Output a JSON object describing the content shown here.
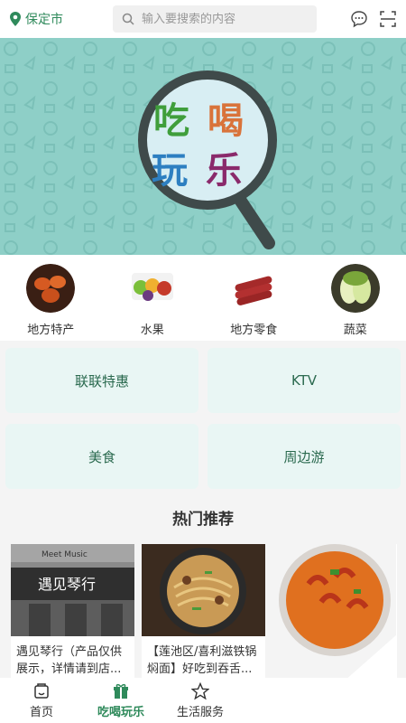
{
  "topbar": {
    "location": "保定市",
    "search_placeholder": "输入要搜索的内容"
  },
  "banner": {
    "text_line1a": "吃",
    "text_line1b": "喝",
    "text_line2a": "玩",
    "text_line2b": "乐"
  },
  "categories": [
    {
      "label": "地方特产"
    },
    {
      "label": "水果"
    },
    {
      "label": "地方零食"
    },
    {
      "label": "蔬菜"
    }
  ],
  "tiles": [
    {
      "label": "联联特惠"
    },
    {
      "label": "KTV"
    },
    {
      "label": "美食"
    },
    {
      "label": "周边游"
    }
  ],
  "hot": {
    "title": "热门推荐",
    "cards": [
      {
        "title": "遇见琴行（产品仅供展示，详情请到店...",
        "sign": "遇见琴行",
        "sign_en": "Meet Music"
      },
      {
        "title": "【莲池区/喜利滋铁锅焖面】好吃到吞舌..."
      },
      {
        "title": ""
      }
    ]
  },
  "bottom_nav": [
    {
      "label": "首页"
    },
    {
      "label": "吃喝玩乐"
    },
    {
      "label": "生活服务"
    }
  ],
  "colors": {
    "brand_green": "#2f8a5b",
    "banner_bg": "#8ecfc7",
    "tile_bg": "#e9f6f4"
  }
}
